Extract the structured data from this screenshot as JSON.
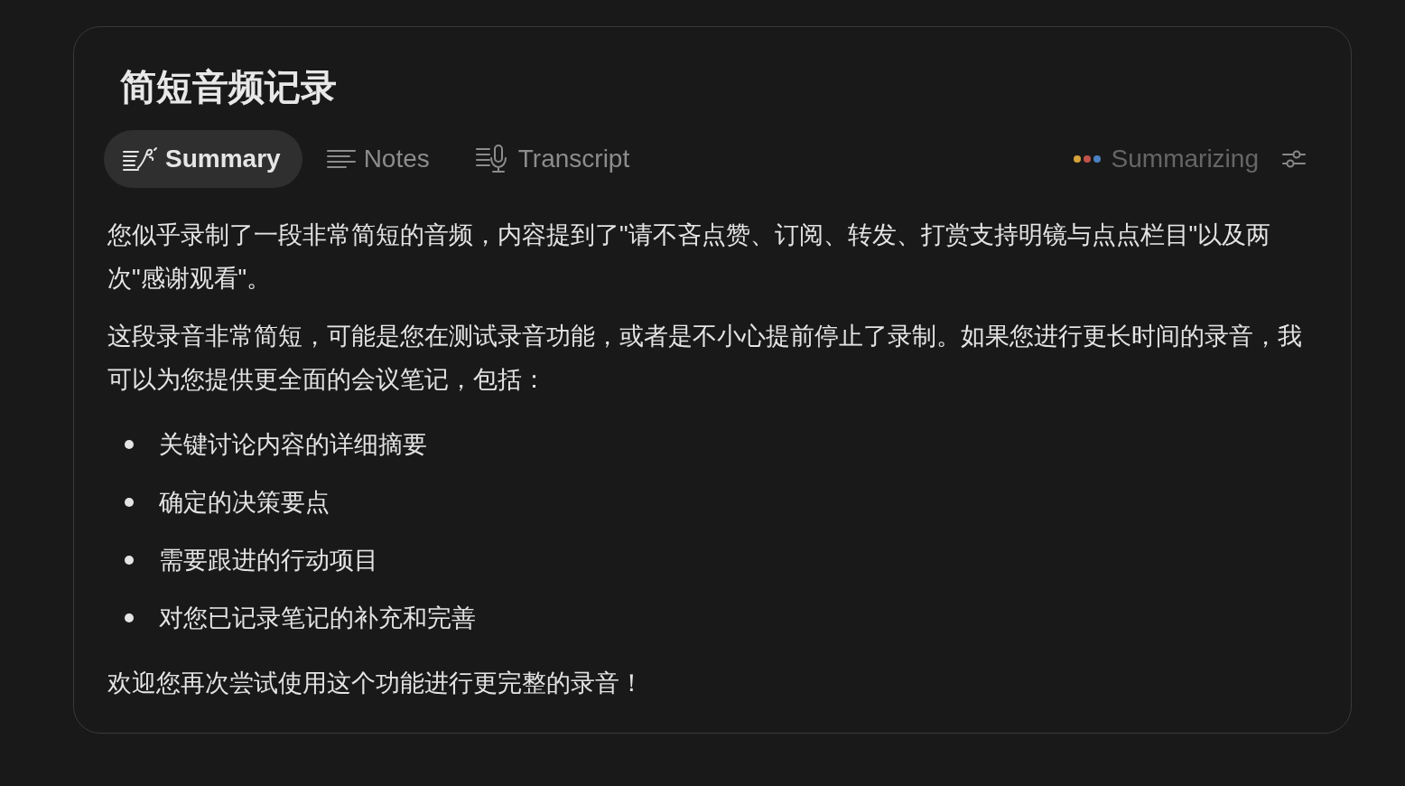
{
  "title": "简短音频记录",
  "tabs": [
    {
      "label": "Summary",
      "kind": "summary",
      "selected": true
    },
    {
      "label": "Notes",
      "kind": "notes",
      "selected": false
    },
    {
      "label": "Transcript",
      "kind": "transcript",
      "selected": false
    }
  ],
  "status": {
    "label": "Summarizing",
    "dots": [
      {
        "color": "#d6a23b"
      },
      {
        "color": "#c0524b"
      },
      {
        "color": "#4b80c2"
      }
    ]
  },
  "content": [
    {
      "kind": "paragraph",
      "text": "您似乎录制了一段非常简短的音频，内容提到了\"请不吝点赞、订阅、转发、打赏支持明镜与点点栏目\"以及两次\"感谢观看\"。"
    },
    {
      "kind": "paragraph",
      "text": "这段录音非常简短，可能是您在测试录音功能，或者是不小心提前停止了录制。如果您进行更长时间的录音，我可以为您提供更全面的会议笔记，包括："
    },
    {
      "kind": "list",
      "items": [
        "关键讨论内容的详细摘要",
        "确定的决策要点",
        "需要跟进的行动项目",
        "对您已记录笔记的补充和完善"
      ]
    },
    {
      "kind": "paragraph",
      "text": "欢迎您再次尝试使用这个功能进行更完整的录音！"
    }
  ]
}
